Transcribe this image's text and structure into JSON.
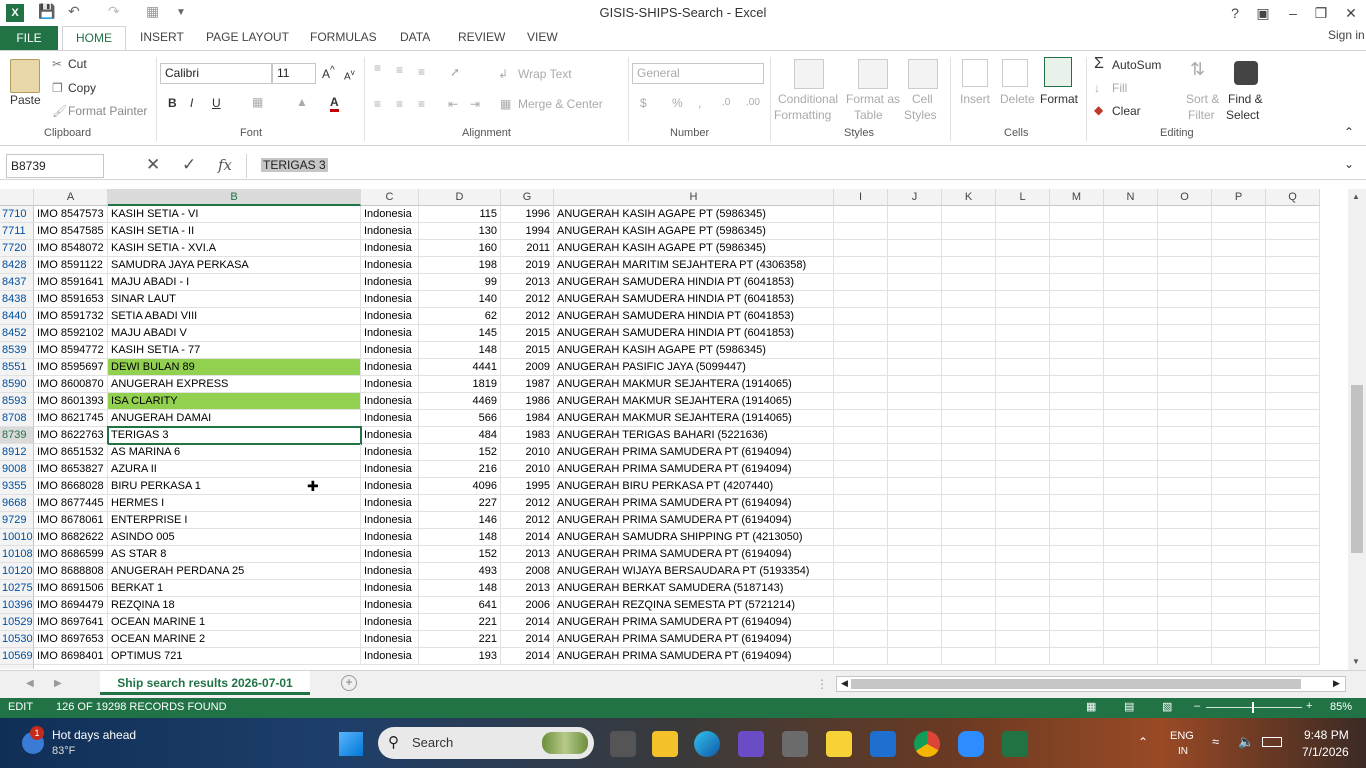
{
  "title": "GISIS-SHIPS-Search - Excel",
  "signin": "Sign in",
  "tabs": [
    "FILE",
    "HOME",
    "INSERT",
    "PAGE LAYOUT",
    "FORMULAS",
    "DATA",
    "REVIEW",
    "VIEW"
  ],
  "clipboard": {
    "paste": "Paste",
    "cut": "Cut",
    "copy": "Copy",
    "format_painter": "Format Painter",
    "group": "Clipboard"
  },
  "font": {
    "name": "Calibri",
    "size": "11",
    "group": "Font",
    "bold": "B",
    "italic": "I",
    "underline": "U"
  },
  "alignment": {
    "wrap": "Wrap Text",
    "merge": "Merge & Center",
    "group": "Alignment"
  },
  "number": {
    "format": "General",
    "group": "Number",
    "currency": "$",
    "percent": "%",
    "comma": ","
  },
  "styles": {
    "conditional": "Conditional",
    "conditional2": "Formatting",
    "format_as": "Format as",
    "format_as2": "Table",
    "cell": "Cell",
    "cell2": "Styles",
    "group": "Styles"
  },
  "cells": {
    "insert": "Insert",
    "delete": "Delete",
    "format": "Format",
    "group": "Cells"
  },
  "editing": {
    "autosum": "AutoSum",
    "fill": "Fill",
    "clear": "Clear",
    "sort": "Sort &",
    "sort2": "Filter",
    "find": "Find &",
    "find2": "Select",
    "group": "Editing"
  },
  "formula_bar": {
    "name_box": "B8739",
    "fx": "fx",
    "value": "TERIGAS 3"
  },
  "columns": [
    "A",
    "B",
    "C",
    "D",
    "G",
    "H",
    "I",
    "J",
    "K",
    "L",
    "M",
    "N",
    "O",
    "P",
    "Q"
  ],
  "rows": [
    {
      "n": "7710",
      "a": "IMO 8547573",
      "b": "KASIH SETIA - VI",
      "c": "Indonesia",
      "d": "115",
      "g": "1996",
      "h": "ANUGERAH KASIH AGAPE PT (5986345)"
    },
    {
      "n": "7711",
      "a": "IMO 8547585",
      "b": "KASIH SETIA - II",
      "c": "Indonesia",
      "d": "130",
      "g": "1994",
      "h": "ANUGERAH KASIH AGAPE PT (5986345)"
    },
    {
      "n": "7720",
      "a": "IMO 8548072",
      "b": "KASIH SETIA - XVI.A",
      "c": "Indonesia",
      "d": "160",
      "g": "2011",
      "h": "ANUGERAH KASIH AGAPE PT (5986345)"
    },
    {
      "n": "8428",
      "a": "IMO 8591122",
      "b": "SAMUDRA JAYA PERKASA",
      "c": "Indonesia",
      "d": "198",
      "g": "2019",
      "h": "ANUGERAH MARITIM SEJAHTERA PT (4306358)"
    },
    {
      "n": "8437",
      "a": "IMO 8591641",
      "b": "MAJU ABADI - I",
      "c": "Indonesia",
      "d": "99",
      "g": "2013",
      "h": "ANUGERAH SAMUDERA HINDIA PT (6041853)"
    },
    {
      "n": "8438",
      "a": "IMO 8591653",
      "b": "SINAR LAUT",
      "c": "Indonesia",
      "d": "140",
      "g": "2012",
      "h": "ANUGERAH SAMUDERA HINDIA PT (6041853)"
    },
    {
      "n": "8440",
      "a": "IMO 8591732",
      "b": "SETIA ABADI VIII",
      "c": "Indonesia",
      "d": "62",
      "g": "2012",
      "h": "ANUGERAH SAMUDERA HINDIA PT (6041853)"
    },
    {
      "n": "8452",
      "a": "IMO 8592102",
      "b": "MAJU ABADI V",
      "c": "Indonesia",
      "d": "145",
      "g": "2015",
      "h": "ANUGERAH SAMUDERA HINDIA PT (6041853)"
    },
    {
      "n": "8539",
      "a": "IMO 8594772",
      "b": "KASIH SETIA - 77",
      "c": "Indonesia",
      "d": "148",
      "g": "2015",
      "h": "ANUGERAH KASIH AGAPE PT (5986345)"
    },
    {
      "n": "8551",
      "a": "IMO 8595697",
      "b": "DEWI BULAN 89",
      "c": "Indonesia",
      "d": "4441",
      "g": "2009",
      "h": "ANUGERAH PASIFIC JAYA (5099447)",
      "hl": true
    },
    {
      "n": "8590",
      "a": "IMO 8600870",
      "b": "ANUGERAH EXPRESS",
      "c": "Indonesia",
      "d": "1819",
      "g": "1987",
      "h": "ANUGERAH MAKMUR SEJAHTERA (1914065)"
    },
    {
      "n": "8593",
      "a": "IMO 8601393",
      "b": "ISA CLARITY",
      "c": "Indonesia",
      "d": "4469",
      "g": "1986",
      "h": "ANUGERAH MAKMUR SEJAHTERA (1914065)",
      "hl": true
    },
    {
      "n": "8708",
      "a": "IMO 8621745",
      "b": "ANUGERAH DAMAI",
      "c": "Indonesia",
      "d": "566",
      "g": "1984",
      "h": "ANUGERAH MAKMUR SEJAHTERA (1914065)"
    },
    {
      "n": "8739",
      "a": "IMO 8622763",
      "b": "TERIGAS 3",
      "c": "Indonesia",
      "d": "484",
      "g": "1983",
      "h": "ANUGERAH TERIGAS BAHARI (5221636)",
      "active": true
    },
    {
      "n": "8912",
      "a": "IMO 8651532",
      "b": "AS MARINA 6",
      "c": "Indonesia",
      "d": "152",
      "g": "2010",
      "h": "ANUGERAH PRIMA SAMUDERA PT (6194094)"
    },
    {
      "n": "9008",
      "a": "IMO 8653827",
      "b": "AZURA II",
      "c": "Indonesia",
      "d": "216",
      "g": "2010",
      "h": "ANUGERAH PRIMA SAMUDERA PT (6194094)"
    },
    {
      "n": "9355",
      "a": "IMO 8668028",
      "b": "BIRU PERKASA 1",
      "c": "Indonesia",
      "d": "4096",
      "g": "1995",
      "h": "ANUGERAH BIRU PERKASA PT (4207440)"
    },
    {
      "n": "9668",
      "a": "IMO 8677445",
      "b": "HERMES I",
      "c": "Indonesia",
      "d": "227",
      "g": "2012",
      "h": "ANUGERAH PRIMA SAMUDERA PT (6194094)"
    },
    {
      "n": "9729",
      "a": "IMO 8678061",
      "b": "ENTERPRISE I",
      "c": "Indonesia",
      "d": "146",
      "g": "2012",
      "h": "ANUGERAH PRIMA SAMUDERA PT (6194094)"
    },
    {
      "n": "10010",
      "a": "IMO 8682622",
      "b": "ASINDO 005",
      "c": "Indonesia",
      "d": "148",
      "g": "2014",
      "h": "ANUGERAH SAMUDRA SHIPPING PT (4213050)"
    },
    {
      "n": "10108",
      "a": "IMO 8686599",
      "b": "AS STAR 8",
      "c": "Indonesia",
      "d": "152",
      "g": "2013",
      "h": "ANUGERAH PRIMA SAMUDERA PT (6194094)"
    },
    {
      "n": "10120",
      "a": "IMO 8688808",
      "b": "ANUGERAH PERDANA 25",
      "c": "Indonesia",
      "d": "493",
      "g": "2008",
      "h": "ANUGERAH WIJAYA BERSAUDARA PT (5193354)"
    },
    {
      "n": "10275",
      "a": "IMO 8691506",
      "b": "BERKAT 1",
      "c": "Indonesia",
      "d": "148",
      "g": "2013",
      "h": "ANUGERAH BERKAT SAMUDERA (5187143)"
    },
    {
      "n": "10396",
      "a": "IMO 8694479",
      "b": "REZQINA 18",
      "c": "Indonesia",
      "d": "641",
      "g": "2006",
      "h": "ANUGERAH REZQINA SEMESTA PT (5721214)"
    },
    {
      "n": "10529",
      "a": "IMO 8697641",
      "b": "OCEAN MARINE 1",
      "c": "Indonesia",
      "d": "221",
      "g": "2014",
      "h": "ANUGERAH PRIMA SAMUDERA PT (6194094)"
    },
    {
      "n": "10530",
      "a": "IMO 8697653",
      "b": "OCEAN MARINE 2",
      "c": "Indonesia",
      "d": "221",
      "g": "2014",
      "h": "ANUGERAH PRIMA SAMUDERA PT (6194094)"
    },
    {
      "n": "10569",
      "a": "IMO 8698401",
      "b": "OPTIMUS 721",
      "c": "Indonesia",
      "d": "193",
      "g": "2014",
      "h": "ANUGERAH PRIMA SAMUDERA PT (6194094)"
    }
  ],
  "sheet_tab": "Ship search results 2026-07-01",
  "status": {
    "mode": "EDIT",
    "records": "126 OF 19298 RECORDS FOUND",
    "zoom": "85%"
  },
  "taskbar": {
    "weather_title": "Hot days ahead",
    "weather_temp": "83°F",
    "badge": "1",
    "search": "Search",
    "lang": "ENG",
    "lang2": "IN",
    "time": "9:48 PM",
    "date": "7/1/2026"
  },
  "colors": {
    "excel_green": "#217346",
    "highlight": "#92d050"
  }
}
